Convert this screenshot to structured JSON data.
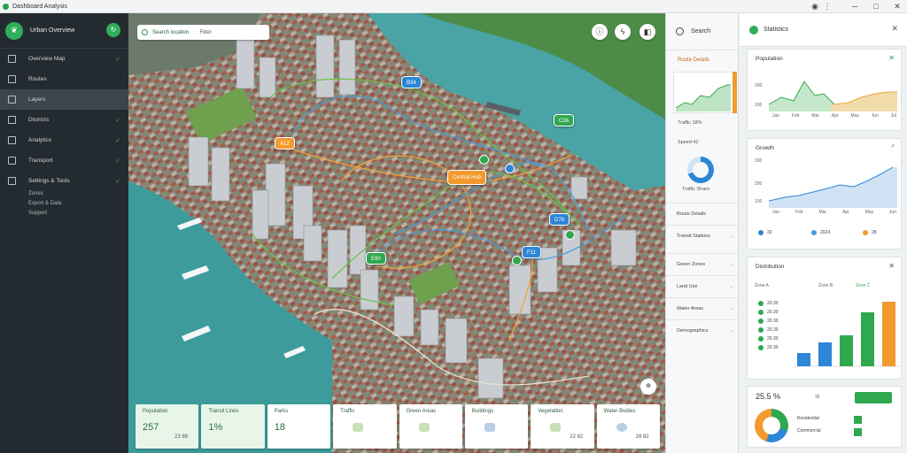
{
  "app": {
    "title": "Dashboard Analysis"
  },
  "sidebar": {
    "header": "Urban Overview",
    "items": [
      {
        "label": "Overview Map",
        "icon": "map-icon"
      },
      {
        "label": "Routes",
        "icon": "route-icon"
      },
      {
        "label": "Layers",
        "icon": "layers-icon"
      },
      {
        "label": "Districts",
        "icon": "grid-icon"
      },
      {
        "label": "Analytics",
        "icon": "chart-icon"
      },
      {
        "label": "Transport",
        "icon": "bus-icon"
      },
      {
        "label": "Settings & Tools",
        "icon": "tools-icon"
      }
    ],
    "extra": [
      {
        "label": "Zones"
      },
      {
        "label": "Export & Data"
      },
      {
        "label": "Support"
      }
    ]
  },
  "map": {
    "search_label": "Search location",
    "search_hint": "Filter",
    "pins": [
      {
        "label": "A12",
        "color": "orange"
      },
      {
        "label": "B34",
        "color": "blue"
      },
      {
        "label": "C56",
        "color": "green"
      },
      {
        "label": "Central Hub",
        "color": "orange"
      },
      {
        "label": "D78",
        "color": "blue"
      },
      {
        "label": "E90",
        "color": "green"
      },
      {
        "label": "F11",
        "color": "blue"
      }
    ],
    "cards": [
      {
        "title": "Population",
        "value": "257",
        "sub": "23 86"
      },
      {
        "title": "Transit Lines",
        "value": "1%",
        "sub": ""
      },
      {
        "title": "Parks",
        "value": "18",
        "sub": ""
      },
      {
        "title": "Traffic",
        "value": "",
        "sub": ""
      },
      {
        "title": "Green Areas",
        "value": "",
        "sub": ""
      },
      {
        "title": "Buildings",
        "value": "",
        "sub": ""
      },
      {
        "title": "Vegetation",
        "value": "",
        "sub": "22 82"
      },
      {
        "title": "Water Bodies",
        "value": "",
        "sub": "28 82"
      }
    ]
  },
  "left_panel": {
    "search": "Search",
    "section": "Route Details",
    "rows": [
      "Traffic 18%",
      "Speed 42",
      "Distance"
    ],
    "donut_caption": "Traffic Share",
    "list": [
      "Route Details",
      "Transit Stations",
      "Green Zones",
      "Land Use",
      "Water Areas",
      "Demographics"
    ]
  },
  "right_panel": {
    "title": "Statistics",
    "panel1": {
      "title": "Population",
      "y": [
        "200",
        "100"
      ],
      "x": [
        "Jan",
        "Feb",
        "Mar",
        "Apr",
        "May",
        "Jun",
        "Jul"
      ]
    },
    "panel2": {
      "title": "Growth",
      "y": [
        "300",
        "200",
        "100"
      ],
      "x": [
        "Jan",
        "Feb",
        "Mar",
        "Apr",
        "May",
        "Jun"
      ],
      "legend": [
        "32",
        "2024",
        "28"
      ]
    },
    "panel3": {
      "title": "Distribution",
      "heads": [
        "Zone A",
        "Zone B",
        "Zone C"
      ],
      "rows": [
        "20.30",
        "20.30",
        "20.30",
        "20.30",
        "20.30",
        "20.30"
      ]
    },
    "footer": {
      "value": "25.5 %",
      "sub": "35",
      "legend": [
        "Residential",
        "Commercial"
      ]
    }
  },
  "colors": {
    "accent": "#2fa84f",
    "orange": "#f29a2e",
    "blue": "#2d86d6"
  }
}
